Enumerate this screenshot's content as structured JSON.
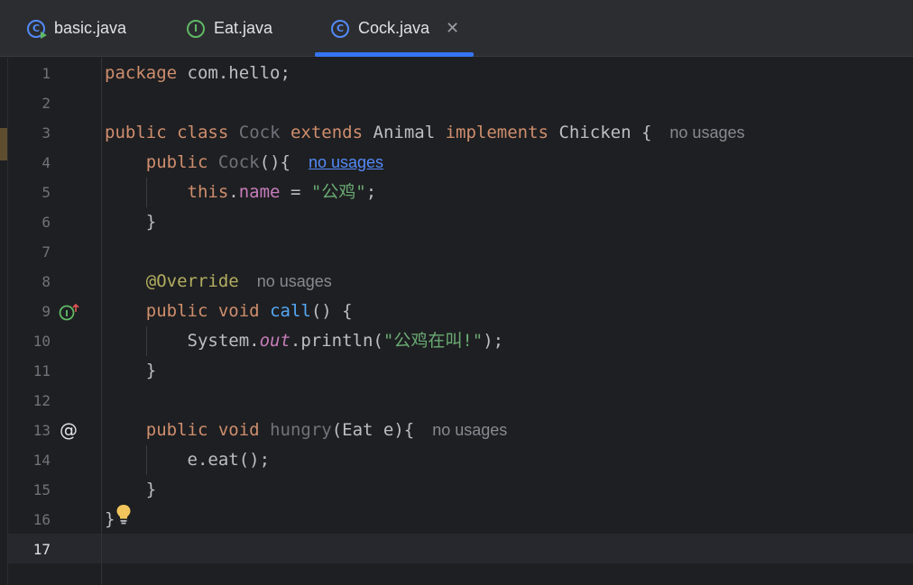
{
  "tabs": [
    {
      "label": "basic.java",
      "icon": "class-run-icon",
      "active": false
    },
    {
      "label": "Eat.java",
      "icon": "interface-icon",
      "active": false
    },
    {
      "label": "Cock.java",
      "icon": "class-icon",
      "active": true,
      "close": "✕"
    }
  ],
  "icon_letters": {
    "class": "C",
    "interface": "I"
  },
  "gutter": {
    "line_numbers": [
      "1",
      "2",
      "3",
      "4",
      "5",
      "6",
      "7",
      "8",
      "9",
      "10",
      "11",
      "12",
      "13",
      "14",
      "15",
      "16",
      "17"
    ],
    "current_line": "17",
    "line9_icon": "implements-interface-method-icon",
    "line13_icon": "@"
  },
  "code": {
    "line1": {
      "kw": "package",
      "rest": " com.hello;"
    },
    "line3": {
      "kw1": "public",
      "kw2": "class",
      "name": "Cock",
      "kw3": "extends",
      "parent": "Animal",
      "kw4": "implements",
      "iface": "Chicken",
      "brace": " {",
      "hint": "no usages"
    },
    "line4": {
      "kw": "public",
      "name": "Cock",
      "rest": "(){",
      "hint": "no usages"
    },
    "line5": {
      "kw": "this",
      "dot": ".",
      "field": "name",
      "eq": " = ",
      "str": "\"公鸡\"",
      "end": ";"
    },
    "line6": {
      "text": "}"
    },
    "line8": {
      "ann": "@Override",
      "hint": "no usages"
    },
    "line9": {
      "kw1": "public",
      "kw2": "void",
      "fn": "call",
      "rest": "() {"
    },
    "line10": {
      "pre": "System.",
      "static": "out",
      "mid": ".println(",
      "str": "\"公鸡在叫!\"",
      "end": ");"
    },
    "line11": {
      "text": "}"
    },
    "line13": {
      "kw1": "public",
      "kw2": "void",
      "fn": "hungry",
      "rest": "(Eat e){",
      "hint": "no usages"
    },
    "line14": {
      "text": "e.eat();"
    },
    "line15": {
      "text": "}"
    },
    "line16": {
      "text": "}"
    }
  },
  "colors": {
    "keyword": "#cf8e6d",
    "function": "#56a8f5",
    "string": "#6aab73",
    "field": "#c77dbb",
    "annotation": "#b3ae60",
    "accent": "#3574f0"
  }
}
